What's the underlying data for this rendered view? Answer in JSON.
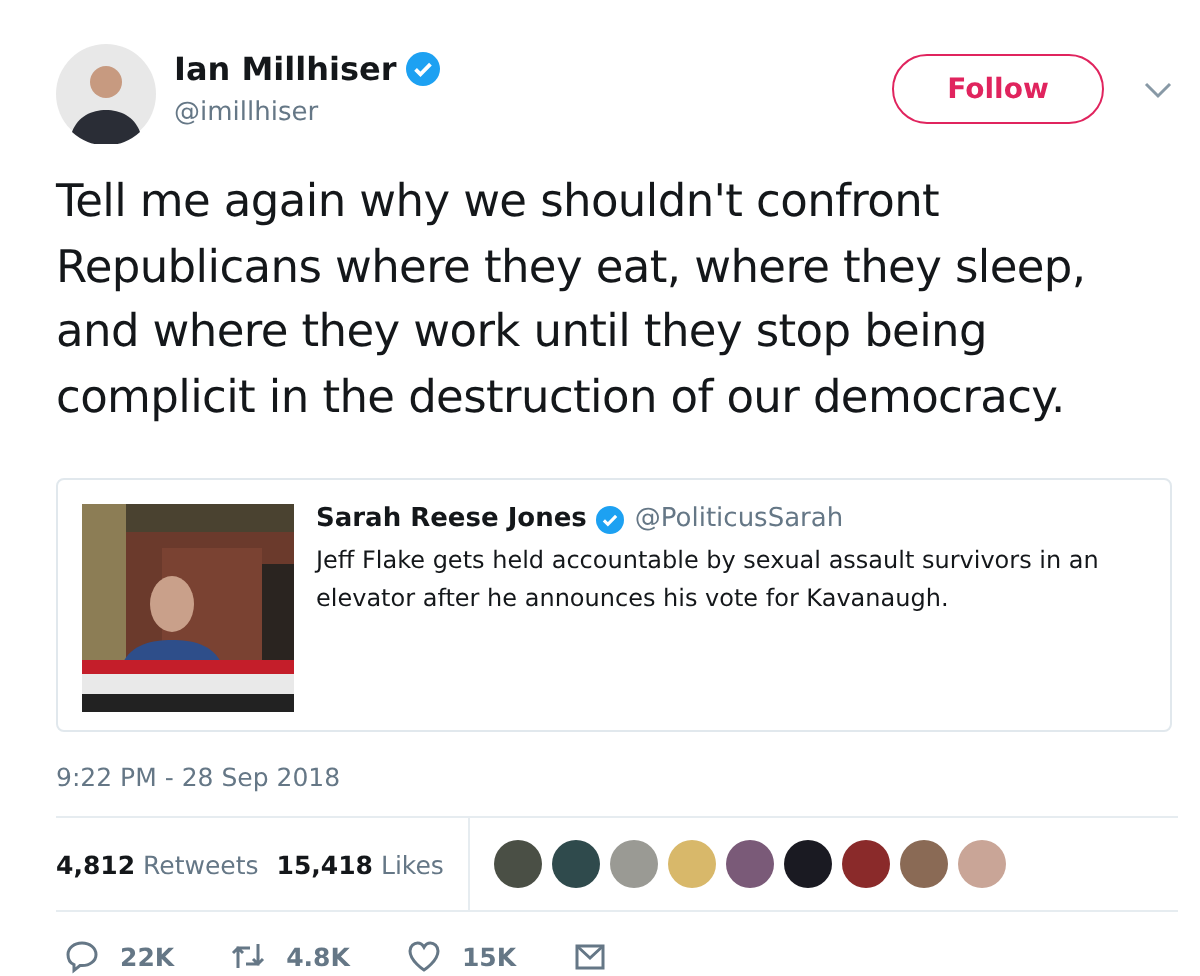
{
  "author": {
    "name": "Ian Millhiser",
    "handle": "@imillhiser",
    "verified": true
  },
  "follow_button": {
    "label": "Follow"
  },
  "tweet_text": "Tell me again why we shouldn't confront Republicans where they eat, where they sleep, and where they work until they stop being complicit in the destruction of our democracy.",
  "quoted_tweet": {
    "name": "Sarah Reese Jones",
    "verified": true,
    "handle": "@PoliticusSarah",
    "text": "Jeff Flake gets held accountable by sexual assault survivors in an elevator after he announces his vote for Kavanaugh."
  },
  "timestamp": "9:22 PM - 28 Sep 2018",
  "stats": [
    {
      "count": "4,812",
      "label": "Retweets"
    },
    {
      "count": "15,418",
      "label": "Likes"
    }
  ],
  "likers": [
    {
      "color": "#4a4f45"
    },
    {
      "color": "#2f4a4c"
    },
    {
      "color": "#9a9a94"
    },
    {
      "color": "#d8b86a"
    },
    {
      "color": "#7a5a78"
    },
    {
      "color": "#1a1a22"
    },
    {
      "color": "#8a2a2a"
    },
    {
      "color": "#8a6a55"
    },
    {
      "color": "#c9a597"
    }
  ],
  "actions": [
    {
      "kind": "reply",
      "count": "22K"
    },
    {
      "kind": "retweet",
      "count": "4.8K"
    },
    {
      "kind": "like",
      "count": "15K"
    },
    {
      "kind": "message"
    }
  ]
}
